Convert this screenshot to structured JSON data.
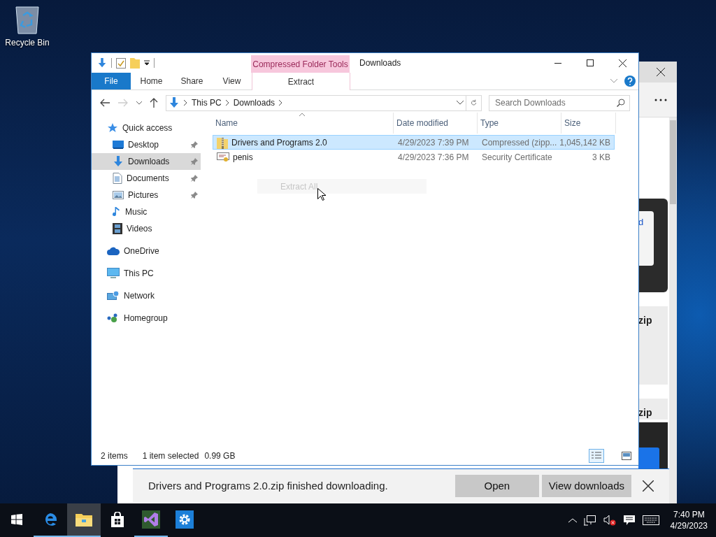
{
  "desktop_icons": [
    {
      "label": "Recycle Bin"
    }
  ],
  "edge": {
    "fragments": [
      {
        "text": "d",
        "kind": "link"
      },
      {
        "text": "zip",
        "kind": "card"
      },
      {
        "text": "zip",
        "kind": "card"
      }
    ],
    "download_bar": {
      "message": "Drivers and Programs 2.0.zip finished downloading.",
      "buttons": [
        "Open",
        "View downloads"
      ]
    }
  },
  "explorer": {
    "title": "Downloads",
    "context_tab": "Compressed Folder Tools",
    "ribbon_tabs": [
      {
        "label": "File",
        "kind": "file",
        "selected": false
      },
      {
        "label": "Home",
        "kind": "tab",
        "selected": false
      },
      {
        "label": "Share",
        "kind": "tab",
        "selected": false
      },
      {
        "label": "View",
        "kind": "tab",
        "selected": false
      },
      {
        "label": "Extract",
        "kind": "context",
        "selected": true
      }
    ],
    "address": {
      "crumbs": [
        "This PC",
        "Downloads"
      ]
    },
    "search": {
      "placeholder": "Search Downloads"
    },
    "nav": [
      {
        "label": "Quick access",
        "kind": "star",
        "selected": false,
        "pinned": false,
        "children": [
          {
            "label": "Desktop",
            "kind": "desktop",
            "selected": false,
            "pinned": true
          },
          {
            "label": "Downloads",
            "kind": "downloads",
            "selected": true,
            "pinned": true
          },
          {
            "label": "Documents",
            "kind": "documents",
            "selected": false,
            "pinned": true
          },
          {
            "label": "Pictures",
            "kind": "pictures",
            "selected": false,
            "pinned": true
          },
          {
            "label": "Music",
            "kind": "music",
            "selected": false,
            "pinned": false
          },
          {
            "label": "Videos",
            "kind": "videos",
            "selected": false,
            "pinned": false
          }
        ]
      },
      {
        "label": "OneDrive",
        "kind": "cloud",
        "selected": false,
        "pinned": false
      },
      {
        "label": "This PC",
        "kind": "pc",
        "selected": false,
        "pinned": false
      },
      {
        "label": "Network",
        "kind": "network",
        "selected": false,
        "pinned": false
      },
      {
        "label": "Homegroup",
        "kind": "homegroup",
        "selected": false,
        "pinned": false
      }
    ],
    "columns": [
      "Name",
      "Date modified",
      "Type",
      "Size"
    ],
    "rows": [
      {
        "name": "Drivers and Programs 2.0",
        "date": "4/29/2023 7:39 PM",
        "type": "Compressed (zipp...",
        "size": "1,045,142 KB",
        "kind": "zip",
        "selected": true
      },
      {
        "name": "penis",
        "date": "4/29/2023 7:36 PM",
        "type": "Security Certificate",
        "size": "3 KB",
        "kind": "certificate",
        "selected": false
      }
    ],
    "context_menu": {
      "items": [
        "Extract All"
      ]
    },
    "status": {
      "count": "2 items",
      "selection": "1 item selected",
      "selection_size": "0.99 GB"
    }
  },
  "taskbar": {
    "apps": [
      {
        "kind": "edge",
        "running": true,
        "active": false
      },
      {
        "kind": "explorer",
        "running": true,
        "active": true
      },
      {
        "kind": "store",
        "running": false,
        "active": false
      },
      {
        "kind": "vs",
        "running": true,
        "active": false
      },
      {
        "kind": "settings",
        "running": false,
        "active": false
      }
    ],
    "clock": {
      "time": "7:40 PM",
      "date": "4/29/2023"
    }
  }
}
